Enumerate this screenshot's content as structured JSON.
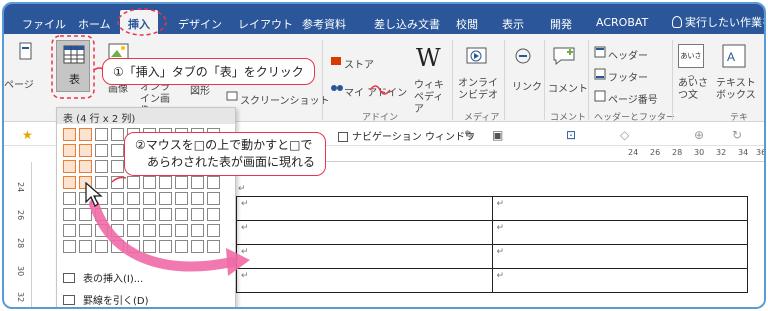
{
  "tabs": [
    {
      "label": "ファイル"
    },
    {
      "label": "ホーム"
    },
    {
      "label": "挿入"
    },
    {
      "label": "デザイン"
    },
    {
      "label": "レイアウト"
    },
    {
      "label": "参考資料"
    },
    {
      "label": "差し込み文書"
    },
    {
      "label": "校閲"
    },
    {
      "label": "表示"
    },
    {
      "label": "開発"
    },
    {
      "label": "ACROBAT"
    }
  ],
  "tell_me": "実行したい作業を",
  "ribbon": {
    "page_label": "ページ",
    "table_label": "表",
    "image_label": "画像",
    "online_images_label": "オンライン画像",
    "shapes_label": "図形",
    "screenshot_label": "スクリーンショット",
    "store_label": "ストア",
    "my_addins_label": "マイ アドイン",
    "wikipedia_label": "ウィキペディア",
    "online_video_label": "オンラインビデオ",
    "link_label": "リンク",
    "comment_label": "コメント",
    "header_label": "ヘッダー",
    "footer_label": "フッター",
    "page_number_label": "ページ番号",
    "greeting_label": "あいさつ文",
    "textbox_label": "テキストボックス",
    "group_addins": "アドイン",
    "group_media": "メディア",
    "group_comment": "コメント",
    "group_header_footer": "ヘッダーとフッター",
    "group_text": "テキ"
  },
  "picker": {
    "title": "表 (4 行 x 2 列)",
    "insert_table": "表の挿入(I)...",
    "draw_table": "罫線を引く(D)"
  },
  "toolbar": {
    "navigation_pane": "ナビゲーション ウィンドウ"
  },
  "ruler_ticks": [
    "24",
    "26",
    "28",
    "30",
    "32",
    "34",
    "36"
  ],
  "vruler_ticks": [
    "24",
    "26",
    "28",
    "30",
    "32"
  ],
  "callouts": {
    "click_insert_table": "①「挿入」タブの「表」をクリック",
    "move_mouse_line1": "②マウスを□の上で動かすと□で",
    "move_mouse_line2": "あらわされた表が画面に現れる"
  },
  "para_mark": "↵",
  "colors": {
    "accent": "#2b579a",
    "callout": "#e8344e",
    "highlight": "#ed7d31",
    "arrow": "#f06aa6"
  }
}
